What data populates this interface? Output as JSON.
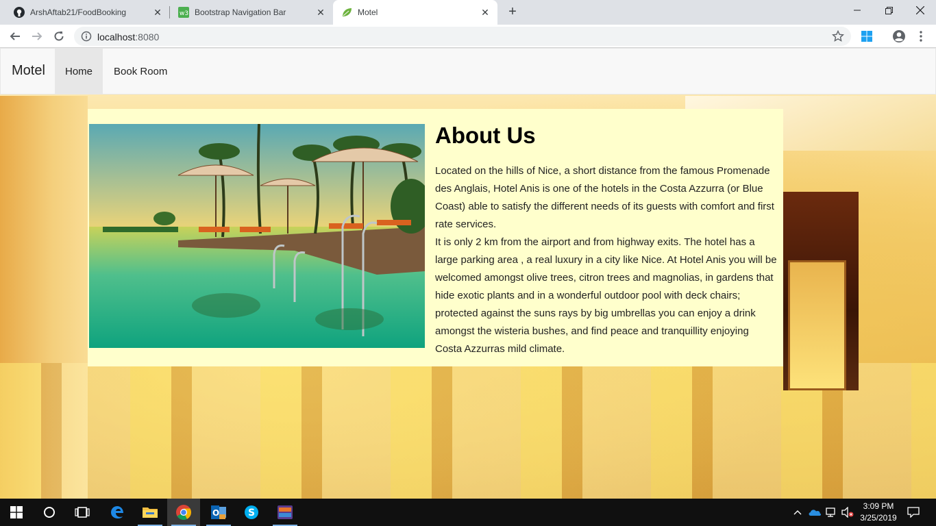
{
  "browser": {
    "tabs": [
      {
        "title": "ArshAftab21/FoodBooking",
        "icon": "github-icon"
      },
      {
        "title": "Bootstrap Navigation Bar",
        "icon": "w3schools-icon"
      },
      {
        "title": "Motel",
        "icon": "leaf-icon"
      }
    ],
    "address": {
      "host": "localhost",
      "port": ":8080"
    }
  },
  "navbar": {
    "brand": "Motel",
    "items": [
      {
        "label": "Home",
        "active": true
      },
      {
        "label": "Book Room",
        "active": false
      }
    ]
  },
  "about": {
    "title": "About Us",
    "paragraph1": "Located on the hills of Nice, a short distance from the famous Promenade des Anglais, Hotel Anis is one of the hotels in the Costa Azzurra (or Blue Coast) able to satisfy the different needs of its guests with comfort and first rate services.",
    "paragraph2": "It is only 2 km from the airport and from highway exits. The hotel has a large parking area , a real luxury in a city like Nice. At Hotel Anis you will be welcomed amongst olive trees, citron trees and magnolias, in gardens that hide exotic plants and in a wonderful outdoor pool with deck chairs; protected against the suns rays by big umbrellas you can enjoy a drink amongst the wisteria bushes, and find peace and tranquillity enjoying Costa Azzurras mild climate."
  },
  "taskbar": {
    "clock_time": "3:09 PM",
    "clock_date": "3/25/2019"
  },
  "colors": {
    "about_bg": "#ffffcc",
    "navbar_bg": "#f8f8f8",
    "taskbar_bg": "#101010"
  }
}
